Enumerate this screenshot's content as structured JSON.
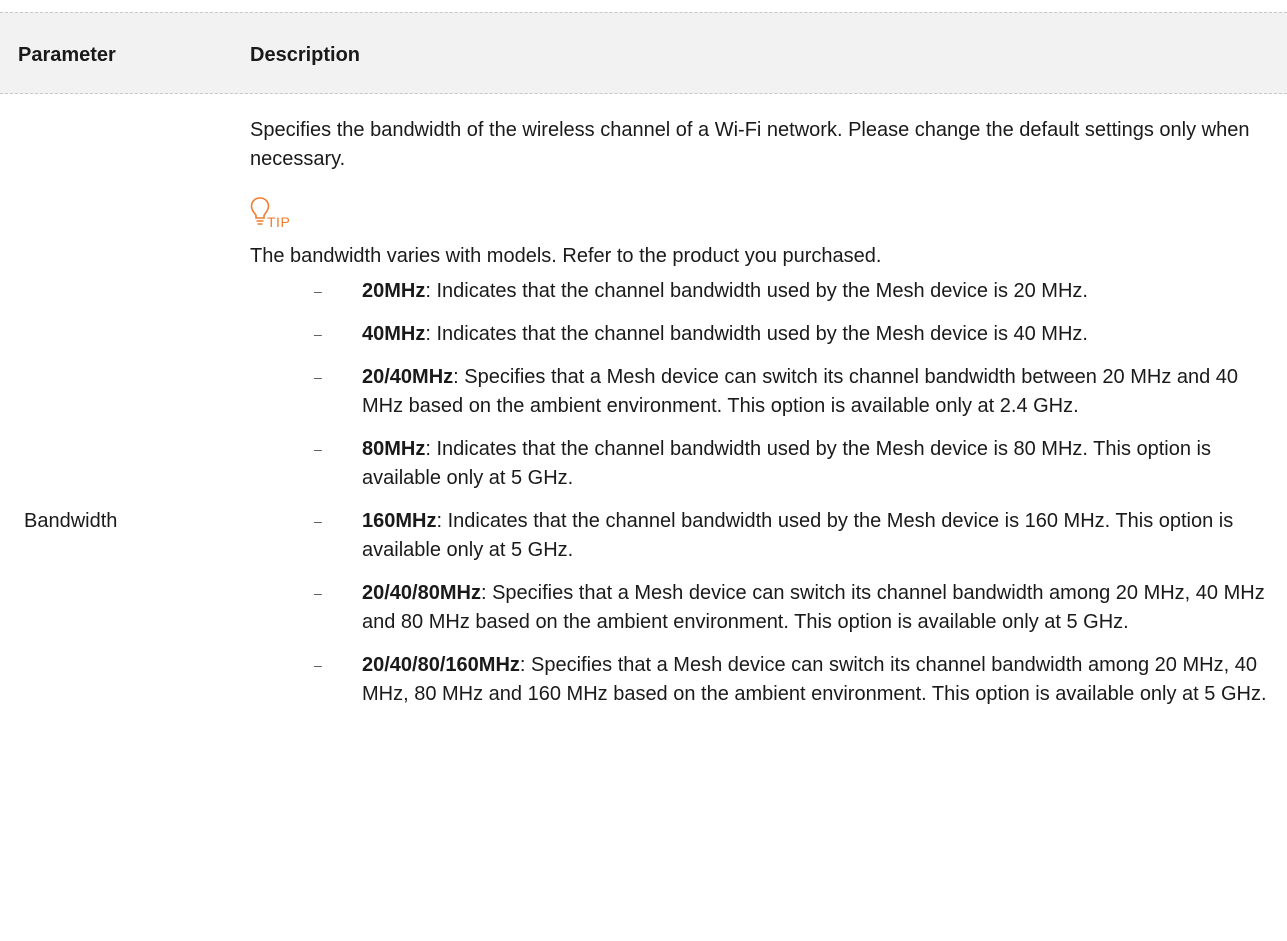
{
  "header": {
    "param_label": "Parameter",
    "desc_label": "Description"
  },
  "row": {
    "parameter": "Bandwidth",
    "intro": "Specifies the bandwidth of the wireless channel of a Wi-Fi network. Please change the default settings only when necessary.",
    "tip": {
      "icon": "lightbulb-icon",
      "label": "TIP",
      "color": "#f07c2e",
      "text": "The bandwidth varies with models. Refer to the product you purchased."
    },
    "bullet_glyph": "–",
    "items": [
      {
        "term": "20MHz",
        "text": ": Indicates that the channel bandwidth used by the Mesh device is 20 MHz."
      },
      {
        "term": "40MHz",
        "text": ": Indicates that the channel bandwidth used by the Mesh device is 40 MHz."
      },
      {
        "term": "20/40MHz",
        "text": ": Specifies that a Mesh device can switch its channel bandwidth between 20 MHz and 40 MHz based on the ambient environment. This option is available only at 2.4 GHz."
      },
      {
        "term": "80MHz",
        "text": ": Indicates that the channel bandwidth used by the Mesh device is 80 MHz. This option is available only at 5 GHz."
      },
      {
        "term": "160MHz",
        "text": ": Indicates that the channel bandwidth used by the Mesh device is 160 MHz. This option is available only at 5 GHz."
      },
      {
        "term": "20/40/80MHz",
        "text": ": Specifies that a Mesh device can switch its channel bandwidth among 20 MHz, 40 MHz and 80 MHz based on the ambient environment. This option is available only at 5 GHz."
      },
      {
        "term": "20/40/80/160MHz",
        "text": ": Specifies that a Mesh device can switch its channel bandwidth among 20 MHz, 40 MHz, 80 MHz and 160 MHz based on the ambient environment. This option is available only at 5 GHz."
      }
    ]
  }
}
